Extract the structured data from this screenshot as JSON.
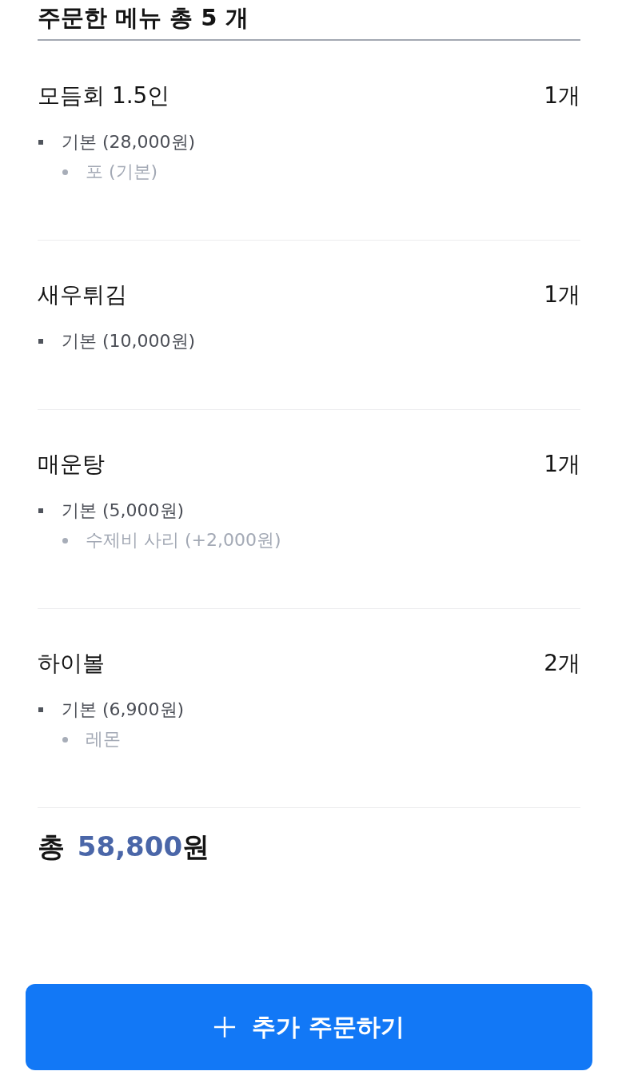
{
  "header": {
    "title": "주문한 메뉴 총 5 개"
  },
  "items": [
    {
      "name": "모듬회 1.5인",
      "quantity": "1개",
      "options": [
        {
          "label": "기본 (28,000원)",
          "children": [
            {
              "label": "포 (기본)"
            }
          ]
        }
      ]
    },
    {
      "name": "새우튀김",
      "quantity": "1개",
      "options": [
        {
          "label": "기본 (10,000원)"
        }
      ]
    },
    {
      "name": "매운탕",
      "quantity": "1개",
      "options": [
        {
          "label": "기본 (5,000원)",
          "children": [
            {
              "label": "수제비 사리 (+2,000원)"
            }
          ]
        }
      ]
    },
    {
      "name": "하이볼",
      "quantity": "2개",
      "options": [
        {
          "label": "기본 (6,900원)",
          "children": [
            {
              "label": "레몬"
            }
          ]
        }
      ]
    }
  ],
  "total": {
    "label": "총",
    "amount": "58,800",
    "unit": "원"
  },
  "button": {
    "label": "추가 주문하기"
  }
}
